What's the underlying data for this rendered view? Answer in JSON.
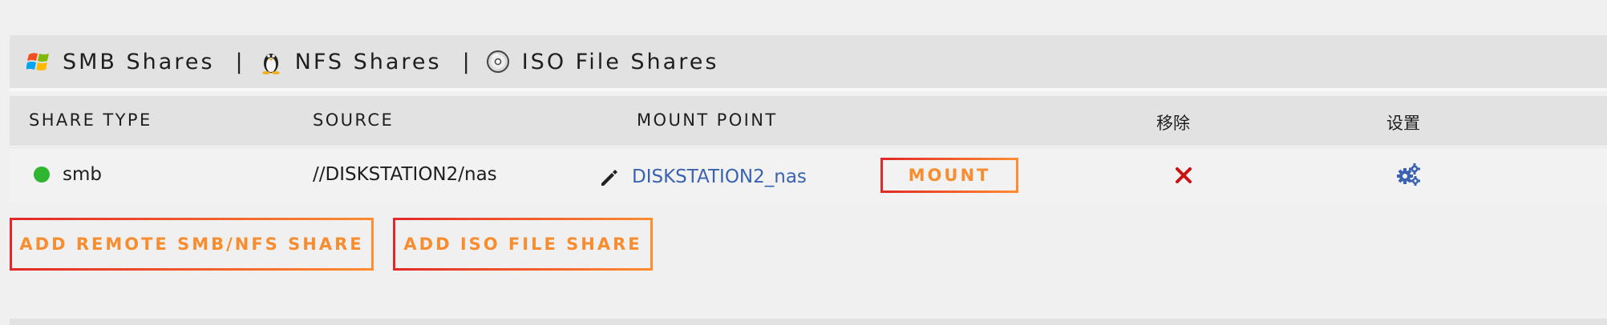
{
  "tabs": [
    {
      "label": "SMB Shares"
    },
    {
      "label": "NFS Shares"
    },
    {
      "label": "ISO File Shares"
    }
  ],
  "separator": "|",
  "table": {
    "headers": {
      "share_type": "SHARE TYPE",
      "source": "SOURCE",
      "mount_point": "MOUNT POINT",
      "remove": "移除",
      "settings": "设置"
    },
    "rows": [
      {
        "type": "smb",
        "source": "//DISKSTATION2/nas",
        "mount_point": "DISKSTATION2_nas",
        "action_label": "MOUNT",
        "status_color": "#2fb52f"
      }
    ]
  },
  "buttons": {
    "add_remote": "ADD REMOTE SMB/NFS SHARE",
    "add_iso": "ADD ISO FILE SHARE"
  },
  "icons": {
    "smb": "windows-icon",
    "nfs": "linux-penguin-icon",
    "iso": "disc-icon",
    "edit": "pencil-icon",
    "remove": "close-x-icon",
    "settings": "gears-icon"
  },
  "colors": {
    "accent_orange": "#f78d2f",
    "accent_red": "#e22828",
    "link_blue": "#3a62b0",
    "remove_red": "#cc1111",
    "status_green": "#2fb52f"
  }
}
